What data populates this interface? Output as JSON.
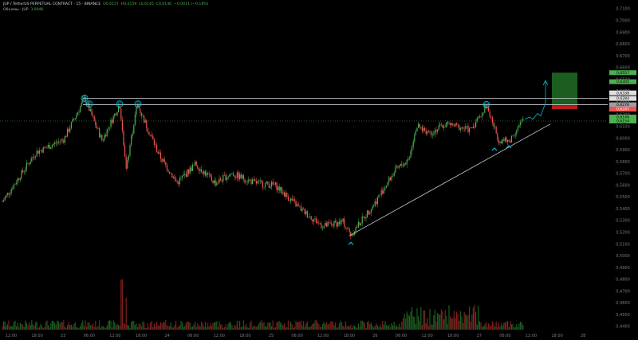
{
  "header": {
    "line1": {
      "symbol": "JUP / TetherUS PERPETUAL CONTRACT · 15 · BINANCE",
      "open": "O0,6157",
      "high": "H0,6159",
      "low": "L0,6145",
      "close": "C0,6146",
      "change": "−0,0011 (−0,18%)"
    },
    "line2": {
      "study": "Объемы · JUP",
      "value": "3,994K"
    }
  },
  "colors": {
    "background": "#000000",
    "up": "#26a69a",
    "up_candle": "#4caf50",
    "down": "#ef5350",
    "level_line": "#d1d4dc",
    "trendline": "#cfd2d8",
    "marker": "#00bcd4",
    "target_box": "#1b5e20",
    "stop_box": "#b71c1c",
    "current_price": "#4caf50"
  },
  "price_axis": {
    "ticks": [
      "0,7100",
      "0,7000",
      "0,6900",
      "0,6800",
      "0,6700",
      "0,6600",
      "0,6500",
      "0,6400",
      "0,6300",
      "0,6200",
      "0,6100",
      "0,6000",
      "0,5900",
      "0,5800",
      "0,5700",
      "0,5600",
      "0,5500",
      "0,5400",
      "0,5300",
      "0,5200",
      "0,5100",
      "0,5000",
      "0,4900",
      "0,4800",
      "0,4700",
      "0,4600",
      "0,4500",
      "0,4400"
    ],
    "labels": {
      "target_top": "0,6557",
      "target_bottom": "0,6305",
      "resistance_top": "0,6338",
      "resistance": "0,6284",
      "entry": "0,6276",
      "stop": "0,6247",
      "current_a": "0,6146",
      "current_b": "0,6154"
    }
  },
  "time_axis": {
    "ticks": [
      "12:00",
      "18:00",
      "23",
      "06:00",
      "12:00",
      "18:00",
      "24",
      "06:00",
      "12:00",
      "18:00",
      "25",
      "06:00",
      "12:00",
      "18:00",
      "26",
      "06:00",
      "12:00",
      "18:00",
      "27",
      "06:00",
      "12:00",
      "18:00",
      "28",
      "06:00"
    ]
  },
  "chart_data": {
    "type": "candlestick",
    "timeframe": "15",
    "ylim": [
      0.44,
      0.71
    ],
    "title": "",
    "xlabel": "",
    "ylabel": "",
    "grid": false,
    "key_points": [
      {
        "label": "start",
        "price": 0.546
      },
      {
        "label": "high 1 (22 06:00)",
        "price": 0.634
      },
      {
        "label": "high 2 (22 12:00)",
        "price": 0.629
      },
      {
        "label": "high 3 (22 15:00)",
        "price": 0.629
      },
      {
        "label": "low (24 12:00)",
        "price": 0.518
      },
      {
        "label": "high (26 06:00)",
        "price": 0.628
      },
      {
        "label": "low (26 15:00)",
        "price": 0.597
      },
      {
        "label": "last",
        "price": 0.6146
      }
    ],
    "horizontal_levels": [
      0.6338,
      0.6284
    ],
    "trendline": {
      "from_price": 0.517,
      "to_price": 0.612
    },
    "markers": [
      {
        "type": "circle",
        "price": 0.634
      },
      {
        "type": "circle",
        "price": 0.629
      },
      {
        "type": "circle",
        "price": 0.629
      },
      {
        "type": "circle",
        "price": 0.629
      },
      {
        "type": "circle",
        "price": 0.6285
      },
      {
        "type": "caret",
        "price": 0.515
      },
      {
        "type": "caret",
        "price": 0.595
      },
      {
        "type": "caret",
        "price": 0.597
      }
    ],
    "position": {
      "entry": 0.6276,
      "target": 0.6557,
      "stop": 0.6247
    }
  }
}
